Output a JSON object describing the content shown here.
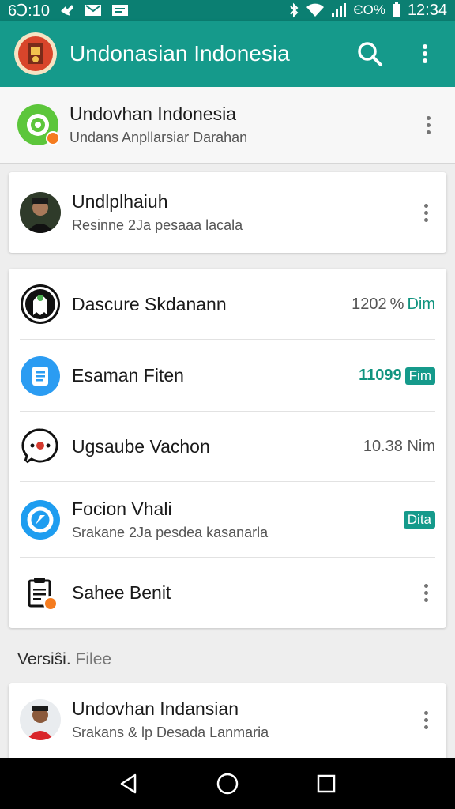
{
  "status_bar": {
    "time_left": "6Ↄ:10",
    "battery_percent": "ЄО%",
    "time_right": "12:34"
  },
  "app_bar": {
    "title": "Undonasian Indonesia",
    "icons": [
      "search-icon",
      "more-vert-icon"
    ]
  },
  "top_item": {
    "title": "Undovhan Indonesia",
    "subtitle": "Undans Anpllarsiar Darahan"
  },
  "card1": {
    "title": "Undlplhaiuh",
    "subtitle": "Resinne 2Ja pesaaa lacala"
  },
  "list": [
    {
      "title": "Dascure Skdanann",
      "meta": "1202",
      "meta_suffix": "%",
      "meta_accent": "Dim"
    },
    {
      "title": "Esaman Fiten",
      "meta": "11099",
      "badge": "Fim"
    },
    {
      "title": "Ugsaube Vachon",
      "meta": "10.38 Nim"
    },
    {
      "title": "Focion Vhali",
      "subtitle": "Srakane 2Ja pesdea kasanarla",
      "badge": "Dita"
    },
    {
      "title": "Sahee Benit"
    }
  ],
  "section": {
    "label": "Versiŝi.",
    "label_light": "Filee"
  },
  "bottom_item": {
    "title": "Undovhan Indansian",
    "subtitle": "Srakans & lp Desada Lanmaria"
  },
  "colors": {
    "app_bar": "#159a8b",
    "status_bar": "#0b7f72",
    "accent_green": "#11947f",
    "badge": "#159a8b"
  },
  "nav": [
    "back-icon",
    "home-icon",
    "recents-icon"
  ]
}
